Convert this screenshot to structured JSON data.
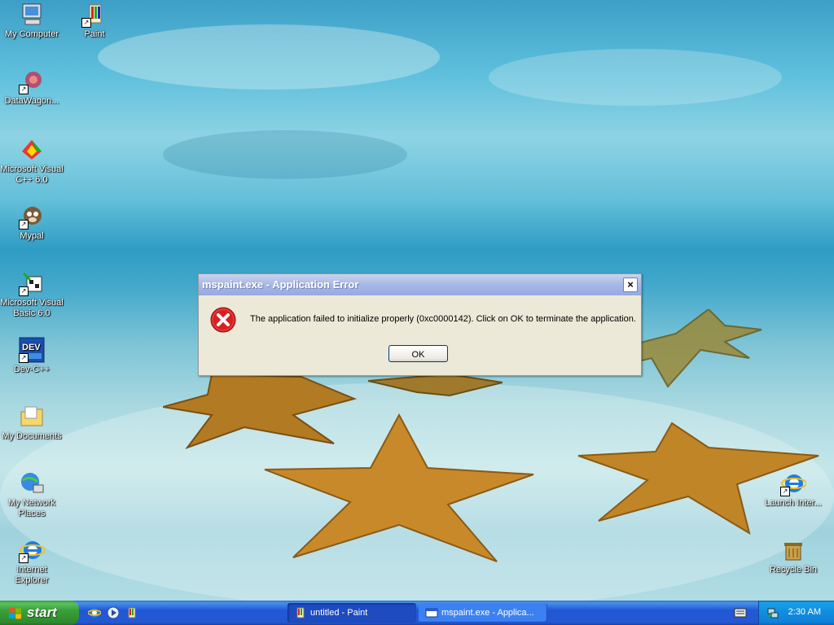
{
  "desktop_icons": [
    {
      "label": "My Computer",
      "icon": "my-computer-icon"
    },
    {
      "label": "Paint",
      "icon": "paint-icon"
    },
    {
      "label": "DataWagon...",
      "icon": "datawagon-icon"
    },
    {
      "label": "Microsoft Visual C++ 6.0",
      "icon": "visual-cpp-icon"
    },
    {
      "label": "Mypal",
      "icon": "mypal-icon"
    },
    {
      "label": "Microsoft Visual Basic 6.0",
      "icon": "visual-basic-icon"
    },
    {
      "label": "Dev-C++",
      "icon": "dev-cpp-icon"
    },
    {
      "label": "My Documents",
      "icon": "my-documents-icon"
    },
    {
      "label": "My Network Places",
      "icon": "network-places-icon"
    },
    {
      "label": "Internet Explorer",
      "icon": "internet-explorer-icon"
    },
    {
      "label": "Launch Inter...",
      "icon": "launch-internet-icon"
    },
    {
      "label": "Recycle Bin",
      "icon": "recycle-bin-icon"
    }
  ],
  "dialog": {
    "title": "mspaint.exe - Application Error",
    "close_label": "×",
    "message": "The application failed to initialize properly (0xc0000142). Click on OK to terminate the application.",
    "ok_label": "OK",
    "icon": "error-icon"
  },
  "taskbar": {
    "start_label": "start",
    "tasks": [
      {
        "label": "untitled - Paint",
        "icon": "paint-icon"
      },
      {
        "label": "mspaint.exe - Applica...",
        "icon": "window-icon"
      }
    ],
    "clock": "2:30 AM"
  },
  "colors": {
    "taskbar_blue": "#2458d2",
    "start_green": "#39a039",
    "dialog_bg": "#ece9d8",
    "error_red": "#d92020"
  }
}
